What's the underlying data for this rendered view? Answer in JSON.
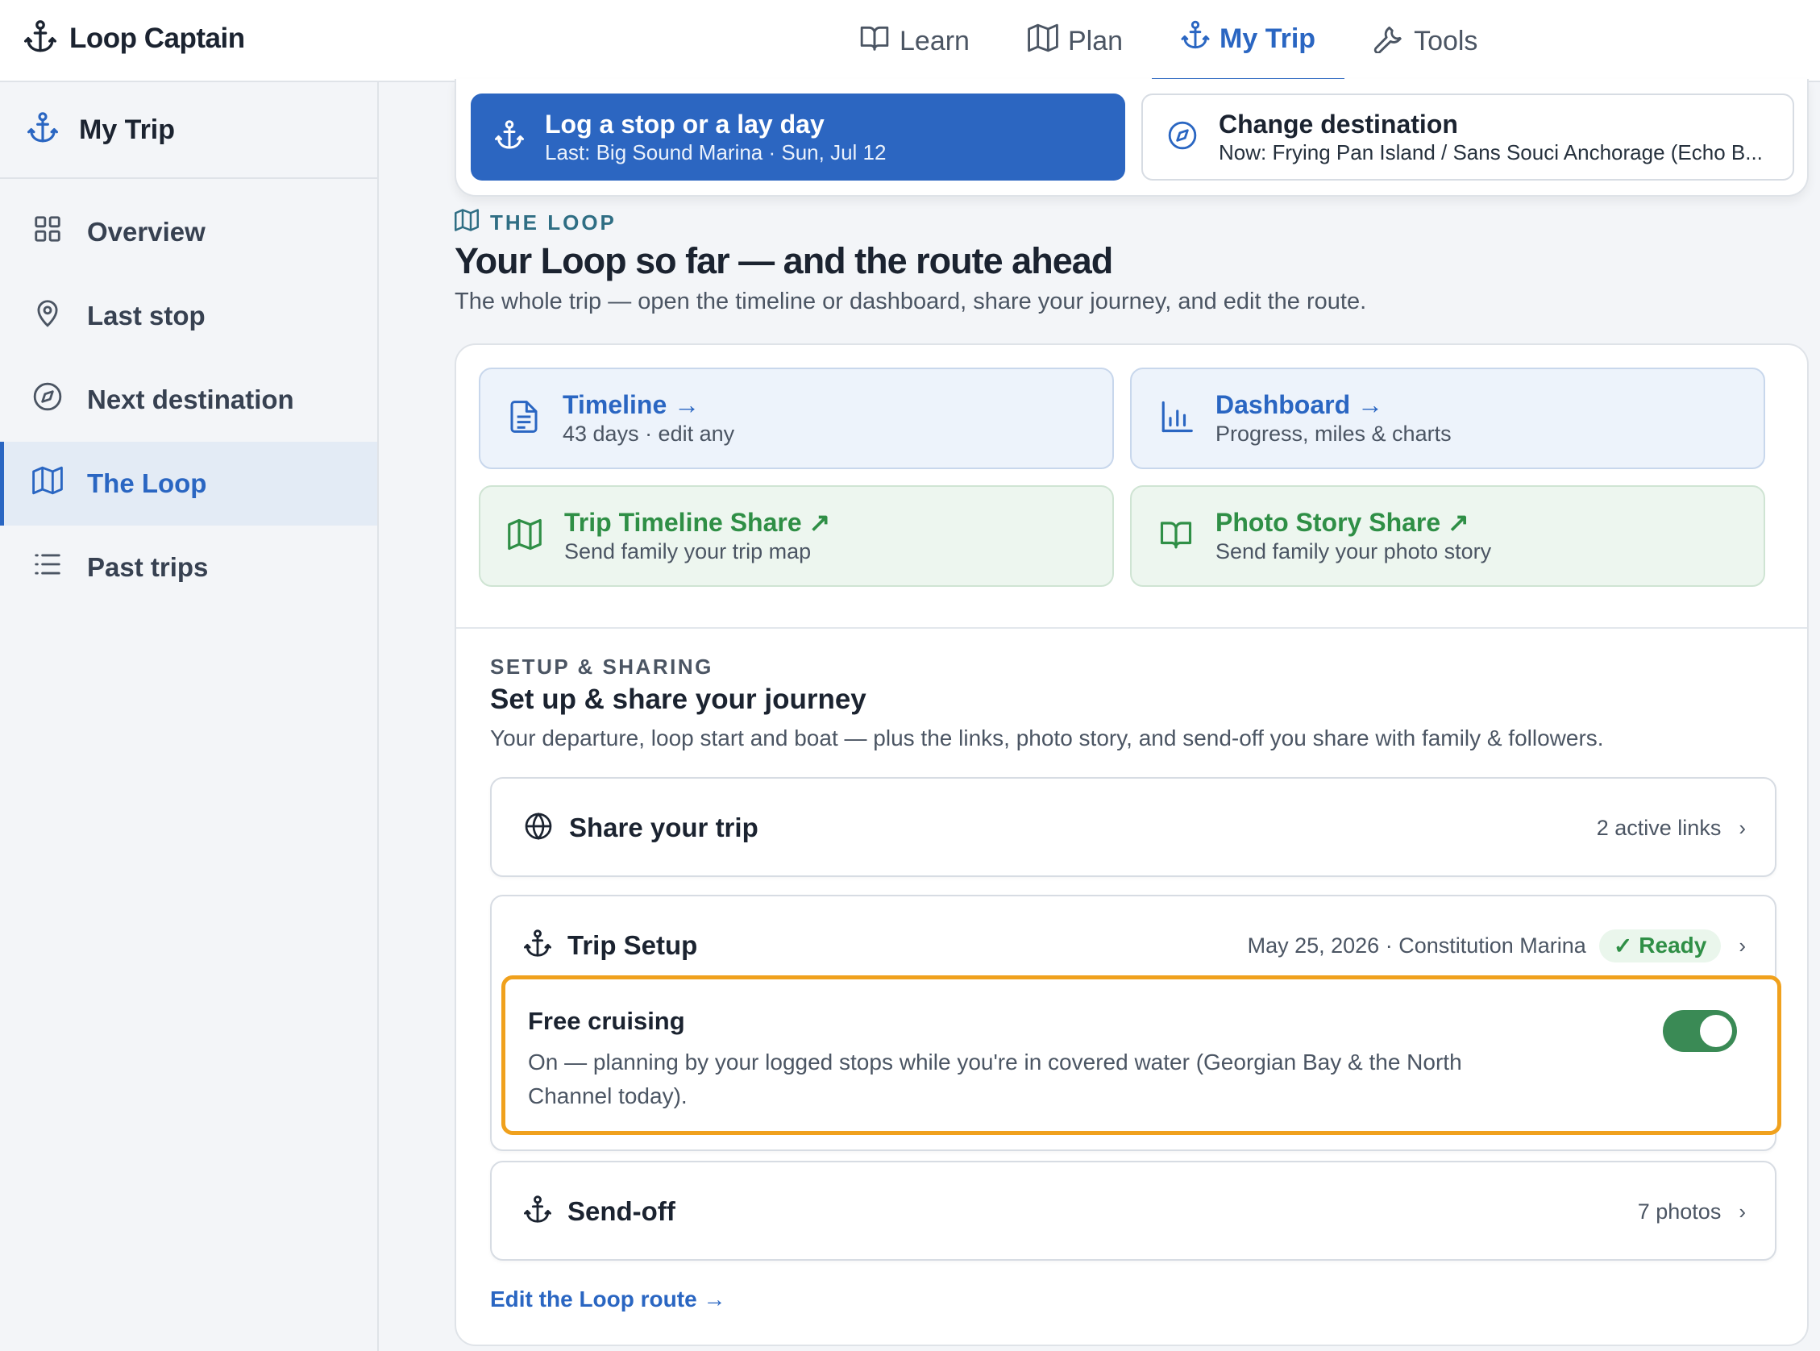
{
  "app": {
    "name": "Loop Captain"
  },
  "topnav": [
    {
      "label": "Learn",
      "icon": "book-icon",
      "active": false
    },
    {
      "label": "Plan",
      "icon": "map-icon",
      "active": false
    },
    {
      "label": "My Trip",
      "icon": "anchor-icon",
      "active": true
    },
    {
      "label": "Tools",
      "icon": "wrench-icon",
      "active": false
    }
  ],
  "sidebar": {
    "title": "My Trip",
    "items": [
      {
        "label": "Overview",
        "icon": "grid-icon",
        "active": false
      },
      {
        "label": "Last stop",
        "icon": "map-pin-icon",
        "active": false
      },
      {
        "label": "Next destination",
        "icon": "compass-icon",
        "active": false
      },
      {
        "label": "The Loop",
        "icon": "map-icon",
        "active": true
      },
      {
        "label": "Past trips",
        "icon": "list-icon",
        "active": false
      }
    ]
  },
  "actions": {
    "log": {
      "title": "Log a stop or a lay day",
      "subtitle": "Last: Big Sound Marina · Sun, Jul 12"
    },
    "destination": {
      "title": "Change destination",
      "subtitle": "Now: Frying Pan Island / Sans Souci Anchorage (Echo B..."
    }
  },
  "loop": {
    "eyebrow": "THE LOOP",
    "title": "Your Loop so far — and the route ahead",
    "description": "The whole trip — open the timeline or dashboard, share your journey, and edit the route."
  },
  "tiles": [
    {
      "title": "Timeline →",
      "subtitle": "43 days · edit any"
    },
    {
      "title": "Dashboard →",
      "subtitle": "Progress, miles & charts"
    },
    {
      "title": "Trip Timeline Share ↗",
      "subtitle": "Send family your trip map"
    },
    {
      "title": "Photo Story Share ↗",
      "subtitle": "Send family your photo story"
    }
  ],
  "setup": {
    "eyebrow": "SETUP & SHARING",
    "title": "Set up & share your journey",
    "description": "Your departure, loop start and boat — plus the links, photo story, and send-off you share with family & followers.",
    "share": {
      "title": "Share your trip",
      "meta": "2 active links"
    },
    "trip_setup": {
      "title": "Trip Setup",
      "meta": "May 25, 2026 · Constitution Marina",
      "status": "Ready"
    },
    "free_cruising": {
      "title": "Free cruising",
      "description": "On — planning by your logged stops while you're in covered water (Georgian Bay & the North Channel today).",
      "enabled": true
    },
    "sendoff": {
      "title": "Send-off",
      "meta": "7 photos"
    },
    "edit_link": "Edit the Loop route →"
  },
  "chevron": "›",
  "check": "✓",
  "colors": {
    "accent": "#2a66c2",
    "green": "#2f8f46",
    "highlight": "#f0a11d",
    "toggle_on": "#3a8a55"
  }
}
